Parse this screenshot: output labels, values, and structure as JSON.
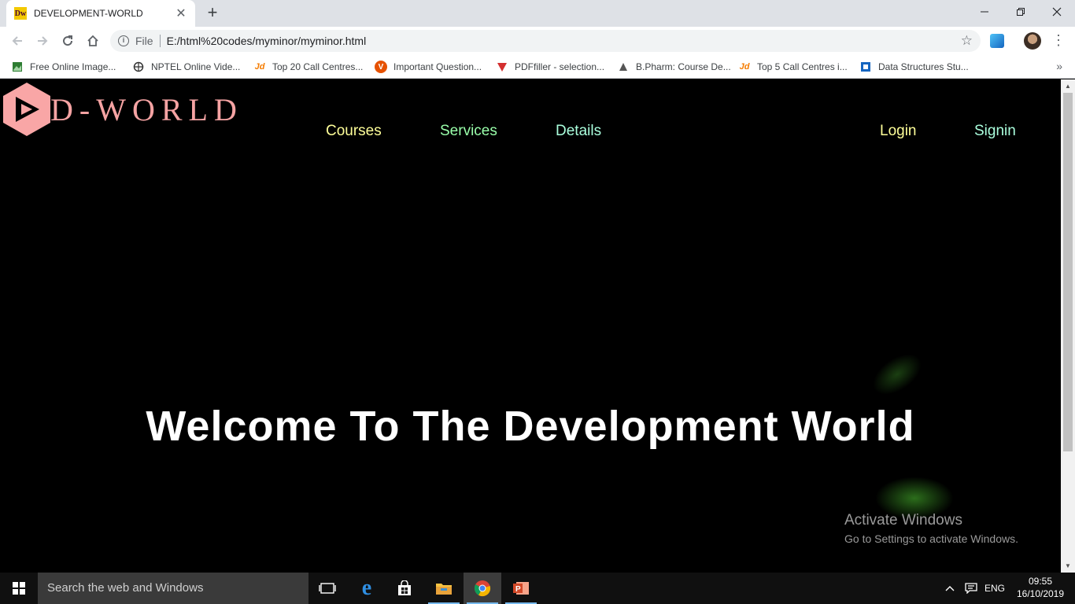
{
  "browser": {
    "tab_title": "DEVELOPMENT-WORLD",
    "tab_favicon_text": "Dw",
    "tab_close": "✕",
    "new_tab": "+",
    "url_scheme_label": "File",
    "url": "E:/html%20codes/myminor/myminor.html"
  },
  "bookmarks": [
    {
      "label": "Free Online Image...",
      "icon": "image-icon",
      "color": "#2e7d32"
    },
    {
      "label": "NPTEL Online Vide...",
      "icon": "nptel-icon",
      "color": "#333333"
    },
    {
      "label": "Top 20 Call Centres...",
      "icon": "justdial-icon",
      "color": "#f57c00"
    },
    {
      "label": "Important Question...",
      "icon": "v-icon",
      "color": "#e65100"
    },
    {
      "label": "PDFfiller - selection...",
      "icon": "pdffiller-icon",
      "color": "#d32f2f"
    },
    {
      "label": "B.Pharm: Course De...",
      "icon": "bpharm-icon",
      "color": "#555555"
    },
    {
      "label": "Top 5 Call Centres i...",
      "icon": "justdial-icon",
      "color": "#f57c00"
    },
    {
      "label": "Data Structures Stu...",
      "icon": "ds-icon",
      "color": "#1565c0"
    }
  ],
  "site": {
    "logo_text": "D-WORLD",
    "logo_color": "#f9a6a6",
    "nav": [
      {
        "label": "Courses",
        "color": "#ffff99"
      },
      {
        "label": "Services",
        "color": "#99ffaa"
      },
      {
        "label": "Details",
        "color": "#aaffdd"
      }
    ],
    "auth": [
      {
        "label": "Login",
        "color": "#ffff99"
      },
      {
        "label": "Signin",
        "color": "#aaffdd"
      }
    ],
    "hero_text": "Welcome To The Development World"
  },
  "watermark": {
    "title": "Activate Windows",
    "subtitle": "Go to Settings to activate Windows."
  },
  "taskbar": {
    "search_placeholder": "Search the web and Windows",
    "language": "ENG",
    "time": "09:55",
    "date": "16/10/2019"
  }
}
